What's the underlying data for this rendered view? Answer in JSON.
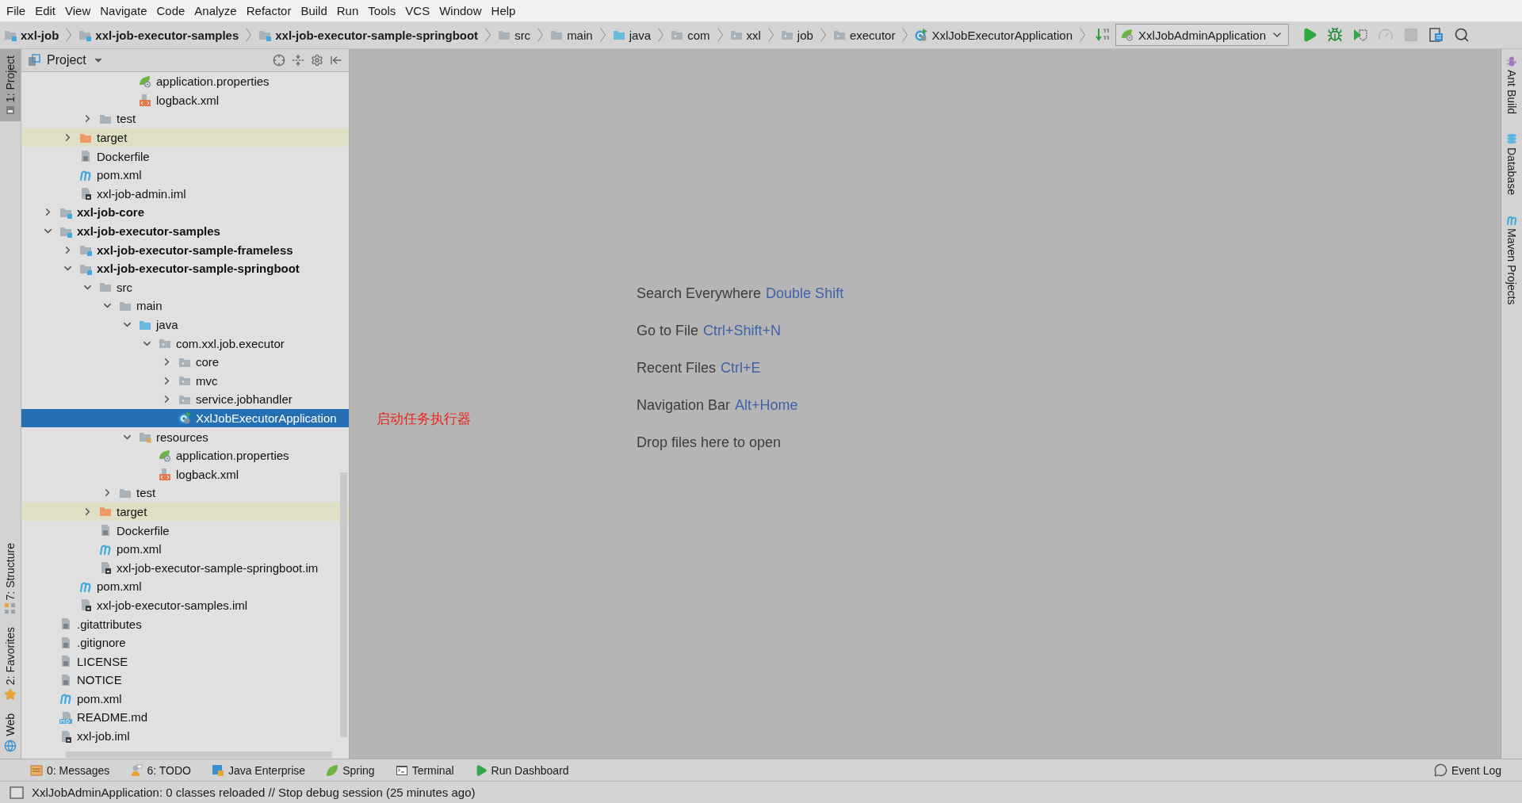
{
  "menu_bar": [
    "File",
    "Edit",
    "View",
    "Navigate",
    "Code",
    "Analyze",
    "Refactor",
    "Build",
    "Run",
    "Tools",
    "VCS",
    "Window",
    "Help"
  ],
  "nav_bar": {
    "crumbs": [
      {
        "label": "xxl-job",
        "kind": "module"
      },
      {
        "label": "xxl-job-executor-samples",
        "kind": "module"
      },
      {
        "label": "xxl-job-executor-sample-springboot",
        "kind": "module"
      },
      {
        "label": "src",
        "kind": "folder"
      },
      {
        "label": "main",
        "kind": "folder"
      },
      {
        "label": "java",
        "kind": "source-folder"
      },
      {
        "label": "com",
        "kind": "package"
      },
      {
        "label": "xxl",
        "kind": "package"
      },
      {
        "label": "job",
        "kind": "package"
      },
      {
        "label": "executor",
        "kind": "package"
      },
      {
        "label": "XxlJobExecutorApplication",
        "kind": "class"
      }
    ],
    "run_config": "XxlJobAdminApplication",
    "tools": [
      {
        "kind": "run",
        "disabled": false
      },
      {
        "kind": "debug",
        "disabled": false
      },
      {
        "kind": "coverage",
        "disabled": false
      },
      {
        "kind": "profile",
        "disabled": true
      },
      {
        "kind": "stop",
        "disabled": true
      },
      {
        "kind": "structure",
        "disabled": false
      },
      {
        "kind": "search",
        "disabled": false
      }
    ]
  },
  "left_stripe": {
    "top": [
      {
        "label": "1: Project",
        "kind": "project",
        "selected": true
      }
    ],
    "bottom": [
      {
        "label": "7: Structure",
        "kind": "structure",
        "selected": false
      },
      {
        "label": "2: Favorites",
        "kind": "favorites",
        "selected": false
      },
      {
        "label": "Web",
        "kind": "web",
        "selected": false
      }
    ]
  },
  "project_panel": {
    "title": "Project",
    "tree": [
      {
        "children": [
          {
            "children": [
              {
                "children": [
                  {
                    "children": [
                      {
                        "label": "application.properties",
                        "kind": "spring-props",
                        "selected": false
                      },
                      {
                        "label": "logback.xml",
                        "kind": "xml",
                        "selected": false
                      }
                    ]
                  }
                ]
              },
              {
                "label": "test",
                "kind": "folder",
                "expanded": false,
                "selected": false
              }
            ]
          },
          {
            "label": "target",
            "kind": "excluded-folder",
            "expanded": false,
            "selected": false
          },
          {
            "label": "Dockerfile",
            "kind": "text-file",
            "selected": false
          },
          {
            "label": "pom.xml",
            "kind": "maven",
            "selected": false
          },
          {
            "label": "xxl-job-admin.iml",
            "kind": "iml",
            "selected": false
          }
        ]
      },
      {
        "label": "xxl-job-core",
        "kind": "module",
        "expanded": false,
        "selected": false
      },
      {
        "label": "xxl-job-executor-samples",
        "kind": "module",
        "expanded": true,
        "selected": false,
        "children": [
          {
            "label": "xxl-job-executor-sample-frameless",
            "kind": "module",
            "expanded": false,
            "selected": false
          },
          {
            "label": "xxl-job-executor-sample-springboot",
            "kind": "module",
            "expanded": true,
            "selected": false,
            "children": [
              {
                "label": "src",
                "kind": "folder",
                "expanded": true,
                "selected": false,
                "children": [
                  {
                    "label": "main",
                    "kind": "folder",
                    "expanded": true,
                    "selected": false,
                    "children": [
                      {
                        "label": "java",
                        "kind": "source-folder",
                        "expanded": true,
                        "selected": false,
                        "children": [
                          {
                            "label": "com.xxl.job.executor",
                            "kind": "package",
                            "expanded": true,
                            "selected": false,
                            "children": [
                              {
                                "label": "core",
                                "kind": "package",
                                "expanded": false,
                                "selected": false
                              },
                              {
                                "label": "mvc",
                                "kind": "package",
                                "expanded": false,
                                "selected": false
                              },
                              {
                                "label": "service.jobhandler",
                                "kind": "package",
                                "expanded": false,
                                "selected": false
                              },
                              {
                                "label": "XxlJobExecutorApplication",
                                "kind": "class",
                                "selected": true
                              }
                            ]
                          }
                        ]
                      },
                      {
                        "label": "resources",
                        "kind": "resources-folder",
                        "expanded": true,
                        "selected": false,
                        "children": [
                          {
                            "label": "application.properties",
                            "kind": "spring-props",
                            "selected": false
                          },
                          {
                            "label": "logback.xml",
                            "kind": "xml",
                            "selected": false
                          }
                        ]
                      }
                    ]
                  },
                  {
                    "label": "test",
                    "kind": "folder",
                    "expanded": false,
                    "selected": false
                  }
                ]
              },
              {
                "label": "target",
                "kind": "excluded-folder",
                "expanded": false,
                "selected": false
              },
              {
                "label": "Dockerfile",
                "kind": "text-file",
                "selected": false
              },
              {
                "label": "pom.xml",
                "kind": "maven",
                "selected": false
              },
              {
                "label": "xxl-job-executor-sample-springboot.im",
                "kind": "iml",
                "selected": false
              }
            ]
          },
          {
            "label": "pom.xml",
            "kind": "maven",
            "selected": false
          },
          {
            "label": "xxl-job-executor-samples.iml",
            "kind": "iml",
            "selected": false
          }
        ]
      },
      {
        "label": ".gitattributes",
        "kind": "text-file",
        "selected": false
      },
      {
        "label": ".gitignore",
        "kind": "text-file",
        "selected": false
      },
      {
        "label": "LICENSE",
        "kind": "text-file",
        "selected": false
      },
      {
        "label": "NOTICE",
        "kind": "text-file",
        "selected": false
      },
      {
        "label": "pom.xml",
        "kind": "maven",
        "selected": false
      },
      {
        "label": "README.md",
        "kind": "markdown",
        "selected": false
      },
      {
        "label": "xxl-job.iml",
        "kind": "iml",
        "selected": false
      }
    ]
  },
  "editor": {
    "hints": [
      {
        "text": "Search Everywhere",
        "shortcut": "Double Shift"
      },
      {
        "text": "Go to File",
        "shortcut": "Ctrl+Shift+N"
      },
      {
        "text": "Recent Files",
        "shortcut": "Ctrl+E"
      },
      {
        "text": "Navigation Bar",
        "shortcut": "Alt+Home"
      },
      {
        "text": "Drop files here to open"
      }
    ],
    "annotation": "启动任务执行器"
  },
  "right_stripe": [
    {
      "label": "Ant Build",
      "kind": "ant"
    },
    {
      "label": "Database",
      "kind": "database"
    },
    {
      "label": "Maven Projects",
      "kind": "maven"
    }
  ],
  "tool_tabs": {
    "left": [
      {
        "label": "0: Messages",
        "kind": "messages"
      },
      {
        "label": "6: TODO",
        "kind": "todo"
      },
      {
        "label": "Java Enterprise",
        "kind": "java-enterprise"
      },
      {
        "label": "Spring",
        "kind": "spring"
      },
      {
        "label": "Terminal",
        "kind": "terminal"
      },
      {
        "label": "Run Dashboard",
        "kind": "run-dashboard"
      }
    ],
    "right": [
      {
        "label": "Event Log",
        "kind": "event-log"
      }
    ]
  },
  "status_bar": {
    "message": "XxlJobAdminApplication: 0 classes reloaded // Stop debug session (25 minutes ago)"
  }
}
